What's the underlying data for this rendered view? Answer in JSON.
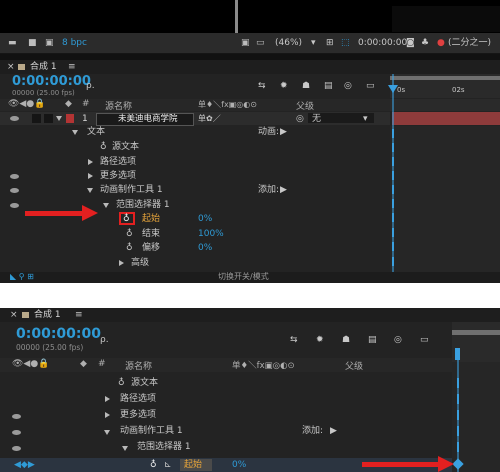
{
  "top_toolbar": {
    "bpc": "8 bpc",
    "zoom": "(46%)",
    "timecode": "0:00:00:00",
    "view": "(二分之一)"
  },
  "panel1": {
    "tab": "合成 1",
    "timecode": "0:00:00:00",
    "fps": "00000 (25.00 fps)",
    "search_placeholder": "ρ.",
    "header": {
      "num": "#",
      "source": "源名称",
      "switches": "单♦＼fx▣◎◐⊙",
      "parent": "父级"
    },
    "ruler": [
      "0s",
      "02s"
    ],
    "layer": {
      "num": "1",
      "name": "未美迪电商学院",
      "parent": "无"
    },
    "rows": [
      {
        "label": "文本",
        "extra": "动画:"
      },
      {
        "label": "源文本"
      },
      {
        "label": "路径选项"
      },
      {
        "label": "更多选项"
      },
      {
        "label": "动画制作工具 1",
        "extra": "添加:"
      },
      {
        "label": "范围选择器 1"
      },
      {
        "label": "起始",
        "value": "0%"
      },
      {
        "label": "结束",
        "value": "100%"
      },
      {
        "label": "偏移",
        "value": "0%"
      },
      {
        "label": "高级"
      }
    ],
    "footer": "切换开关/模式"
  },
  "panel2": {
    "tab": "合成 1",
    "timecode": "0:00:00:00",
    "fps": "00000 (25.00 fps)",
    "search_placeholder": "ρ.",
    "header": {
      "num": "#",
      "source": "源名称",
      "switches": "单♦＼fx▣◎◐⊙",
      "parent": "父级"
    },
    "rows": [
      {
        "label": "源文本"
      },
      {
        "label": "路径选项"
      },
      {
        "label": "更多选项"
      },
      {
        "label": "动画制作工具 1",
        "extra": "添加:"
      },
      {
        "label": "范围选择器 1"
      },
      {
        "label": "起始",
        "value": "0%"
      }
    ]
  },
  "colors": {
    "panel_bg": "#232323",
    "accent_blue": "#2f9bd6",
    "annotation_red": "#e32020",
    "layer_red": "#8e3b3b"
  }
}
